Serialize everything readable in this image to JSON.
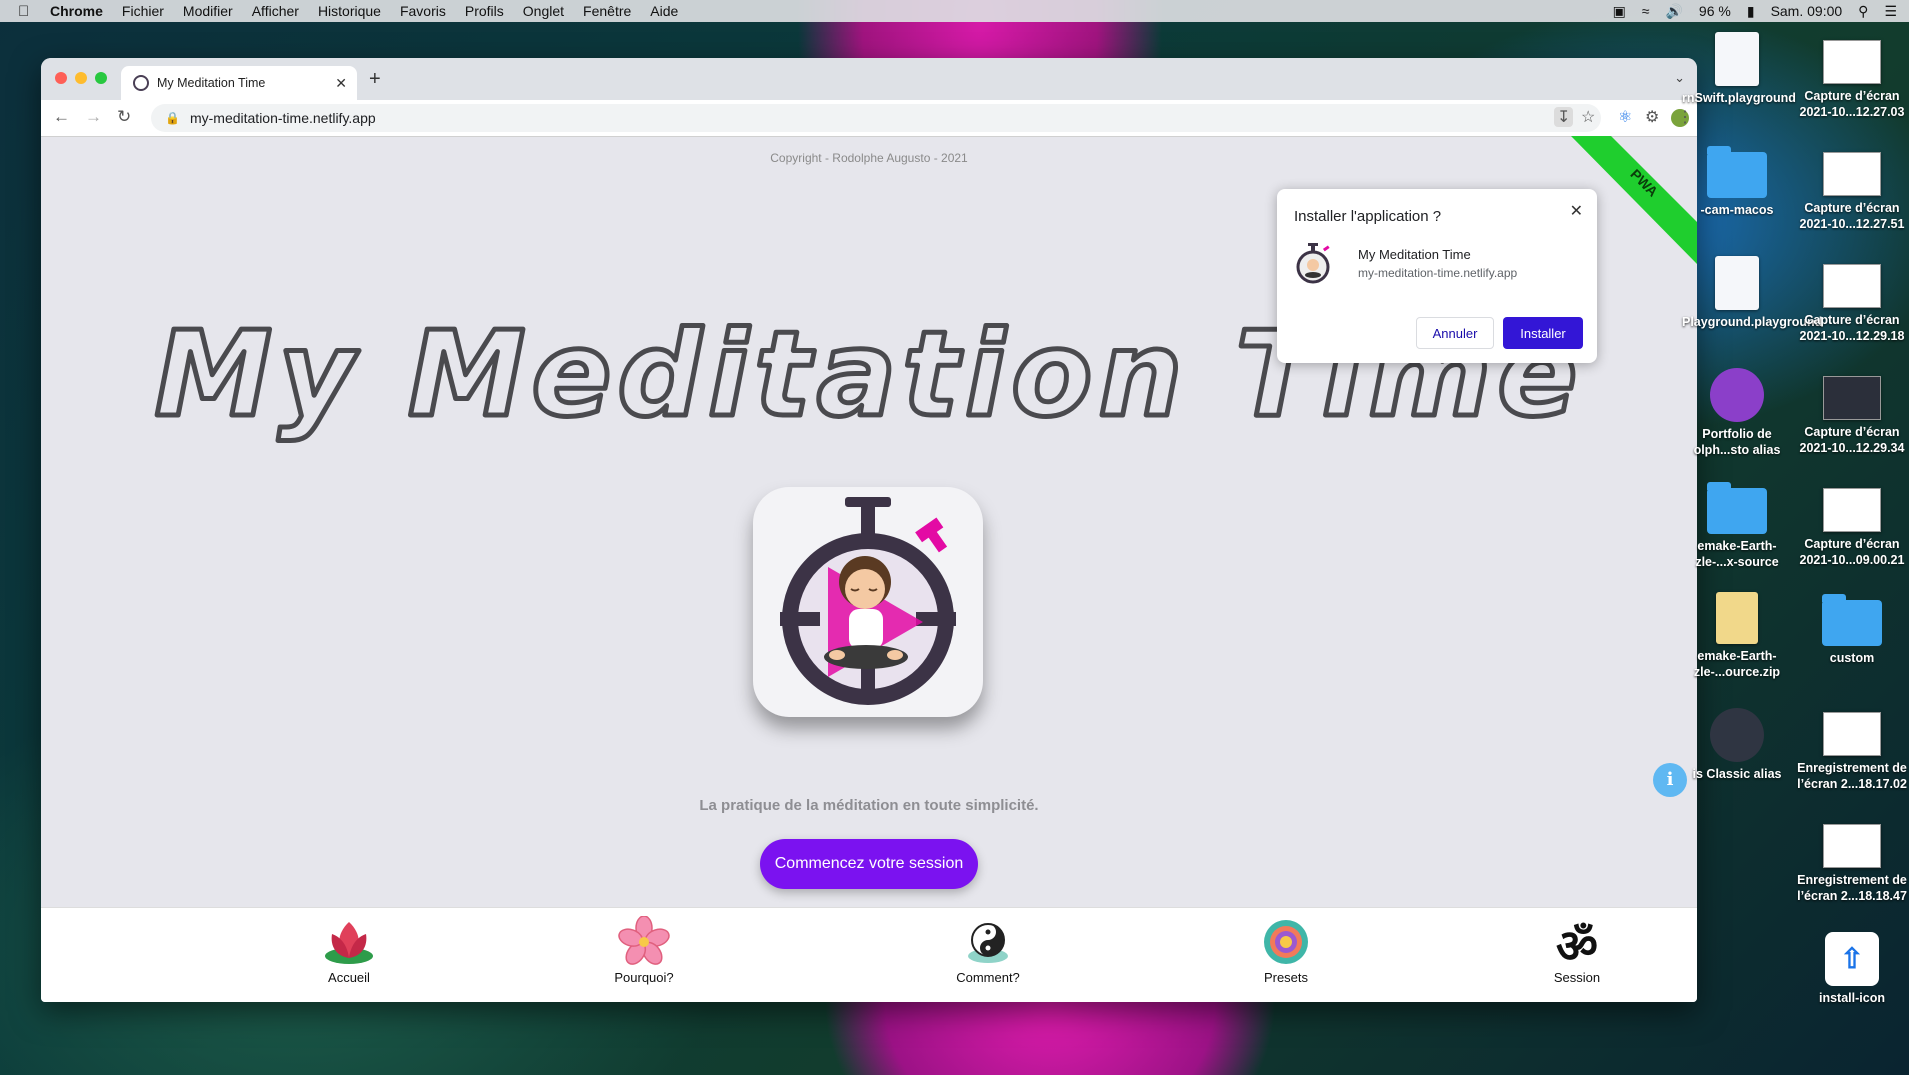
{
  "menubar": {
    "app": "Chrome",
    "items": [
      "Fichier",
      "Modifier",
      "Afficher",
      "Historique",
      "Favoris",
      "Profils",
      "Onglet",
      "Fenêtre",
      "Aide"
    ],
    "battery": "96 %",
    "clock": "Sam. 09:00"
  },
  "browser": {
    "tab_title": "My Meditation Time",
    "url": "my-meditation-time.netlify.app"
  },
  "page": {
    "copyright": "Copyright - Rodolphe Augusto - 2021",
    "hero_title": "My Meditation Time",
    "tagline": "La pratique de la méditation en toute simplicité.",
    "cta": "Commencez votre session",
    "ribbon": "PWA"
  },
  "popup": {
    "title": "Installer l'application ?",
    "app_name": "My Meditation Time",
    "app_url": "my-meditation-time.netlify.app",
    "cancel": "Annuler",
    "install": "Installer"
  },
  "bottom_nav": {
    "home": "Accueil",
    "why": "Pourquoi?",
    "how": "Comment?",
    "presets": "Presets",
    "session": "Session"
  },
  "desktop": {
    "items": [
      {
        "label": "rnSwift.playground"
      },
      {
        "label": "Capture d’écran 2021-10...12.27.03"
      },
      {
        "label": "-cam-macos"
      },
      {
        "label": "Capture d’écran 2021-10...12.27.51"
      },
      {
        "label": "Playground.playground"
      },
      {
        "label": "Capture d’écran 2021-10...12.29.18"
      },
      {
        "label": "Portfolio de olph...sto alias"
      },
      {
        "label": "Capture d’écran 2021-10...12.29.34"
      },
      {
        "label": "emake-Earth-zle-...x-source"
      },
      {
        "label": "Capture d’écran 2021-10...09.00.21"
      },
      {
        "label": "emake-Earth-zle-...ource.zip"
      },
      {
        "label": "custom"
      },
      {
        "label": "is Classic alias"
      },
      {
        "label": "Enregistrement de l’écran 2...18.17.02"
      },
      {
        "label": "Enregistrement de l’écran 2...18.18.47"
      },
      {
        "label": "install-icon"
      }
    ]
  },
  "colors": {
    "cta": "#7b12f0",
    "install_button": "#3316d6",
    "ribbon": "#1fce2e",
    "info": "#5fb8f2"
  }
}
